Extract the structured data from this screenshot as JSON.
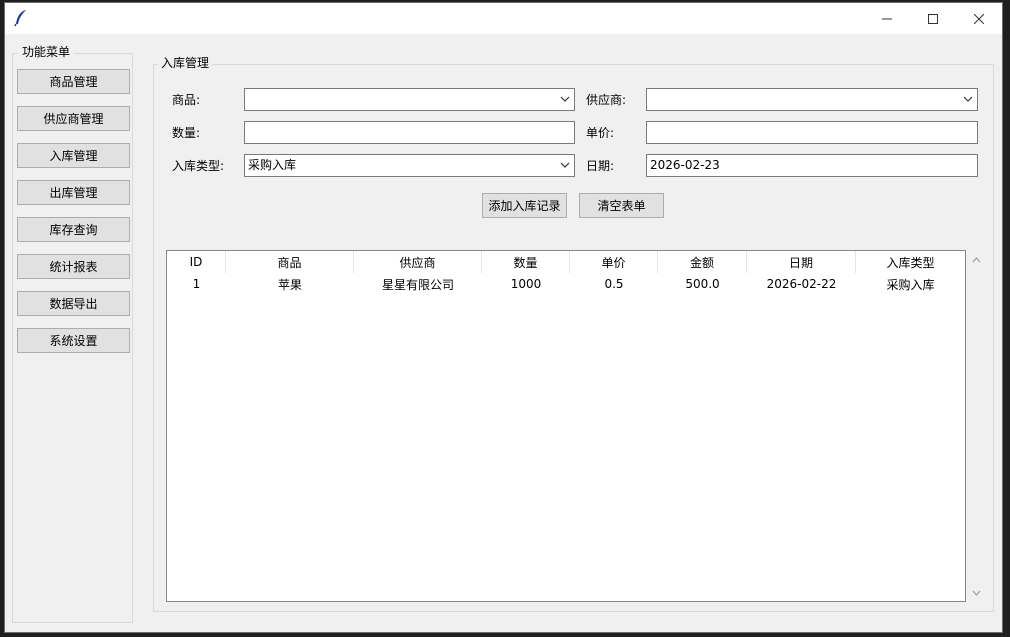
{
  "sidebar": {
    "title": "功能菜单",
    "items": [
      {
        "label": "商品管理"
      },
      {
        "label": "供应商管理"
      },
      {
        "label": "入库管理"
      },
      {
        "label": "出库管理"
      },
      {
        "label": "库存查询"
      },
      {
        "label": "统计报表"
      },
      {
        "label": "数据导出"
      },
      {
        "label": "系统设置"
      }
    ]
  },
  "form": {
    "title": "入库管理",
    "product_label": "商品:",
    "product_value": "",
    "supplier_label": "供应商:",
    "supplier_value": "",
    "quantity_label": "数量:",
    "quantity_value": "",
    "unit_price_label": "单价:",
    "unit_price_value": "",
    "type_label": "入库类型:",
    "type_value": "采购入库",
    "date_label": "日期:",
    "date_value": "2026-02-23",
    "add_button": "添加入库记录",
    "clear_button": "清空表单"
  },
  "table": {
    "columns": [
      "ID",
      "商品",
      "供应商",
      "数量",
      "单价",
      "金额",
      "日期",
      "入库类型"
    ],
    "rows": [
      [
        "1",
        "苹果",
        "星星有限公司",
        "1000",
        "0.5",
        "500.0",
        "2026-02-22",
        "采购入库"
      ]
    ]
  },
  "window": {
    "icon": "feather-icon",
    "controls": [
      "minimize-icon",
      "maximize-icon",
      "close-icon"
    ]
  }
}
